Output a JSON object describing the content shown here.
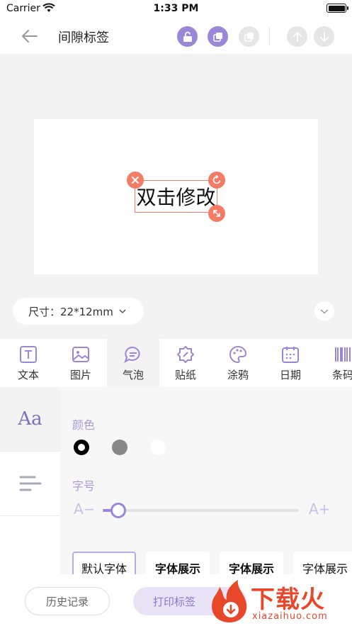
{
  "status": {
    "carrier": "Carrier",
    "time": "1:33 PM"
  },
  "nav": {
    "title": "间隙标签"
  },
  "canvas": {
    "text": "双击修改"
  },
  "size": {
    "label": "尺寸：22*12mm"
  },
  "tabs": [
    {
      "label": "文本"
    },
    {
      "label": "图片"
    },
    {
      "label": "气泡"
    },
    {
      "label": "贴纸"
    },
    {
      "label": "涂鸦"
    },
    {
      "label": "日期"
    },
    {
      "label": "条码"
    }
  ],
  "panel": {
    "font_icon": "Aa",
    "color_label": "颜色",
    "colors": [
      "#000000",
      "#888888",
      "#ffffff"
    ],
    "size_label": "字号",
    "size_minus": "A−",
    "size_plus": "A+",
    "size_level": 0.08,
    "fonts": [
      "默认字体",
      "字体展示",
      "字体展示",
      "字体展示"
    ]
  },
  "bottom": {
    "history": "历史记录",
    "print": "打印标签"
  },
  "watermark": {
    "text": "下载火",
    "url": "xiazaihuo.com"
  },
  "accent": "#9a87d8",
  "selection_color": "#f47c66"
}
